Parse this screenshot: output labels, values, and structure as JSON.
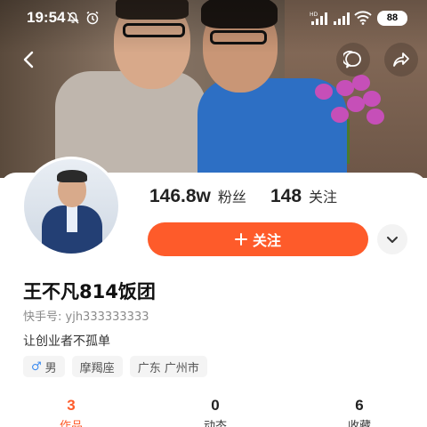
{
  "status_bar": {
    "time": "19:54",
    "battery": "88",
    "icons": [
      "mute-icon",
      "alarm-icon",
      "hd-signal-icon",
      "signal-icon",
      "wifi-icon",
      "battery-icon"
    ]
  },
  "header": {
    "back_icon": "back-arrow-icon",
    "chat_icon": "chat-bubble-icon",
    "share_icon": "share-arrow-icon"
  },
  "profile": {
    "followers_count": "146.8w",
    "followers_label": "粉丝",
    "following_count": "148",
    "following_label": "关注",
    "follow_button_label": "关注",
    "name": "王不凡814饭团",
    "user_id": "快手号: yjh333333333",
    "bio": "让创业者不孤单",
    "tags": {
      "gender": "男",
      "zodiac": "摩羯座",
      "location": "广东 广州市"
    }
  },
  "tabs": [
    {
      "count": "3",
      "label": "作品",
      "active": true
    },
    {
      "count": "0",
      "label": "动态",
      "active": false
    },
    {
      "count": "6",
      "label": "收藏",
      "active": false
    }
  ],
  "colors": {
    "accent": "#fe5b2a",
    "male": "#3d8cf0"
  }
}
